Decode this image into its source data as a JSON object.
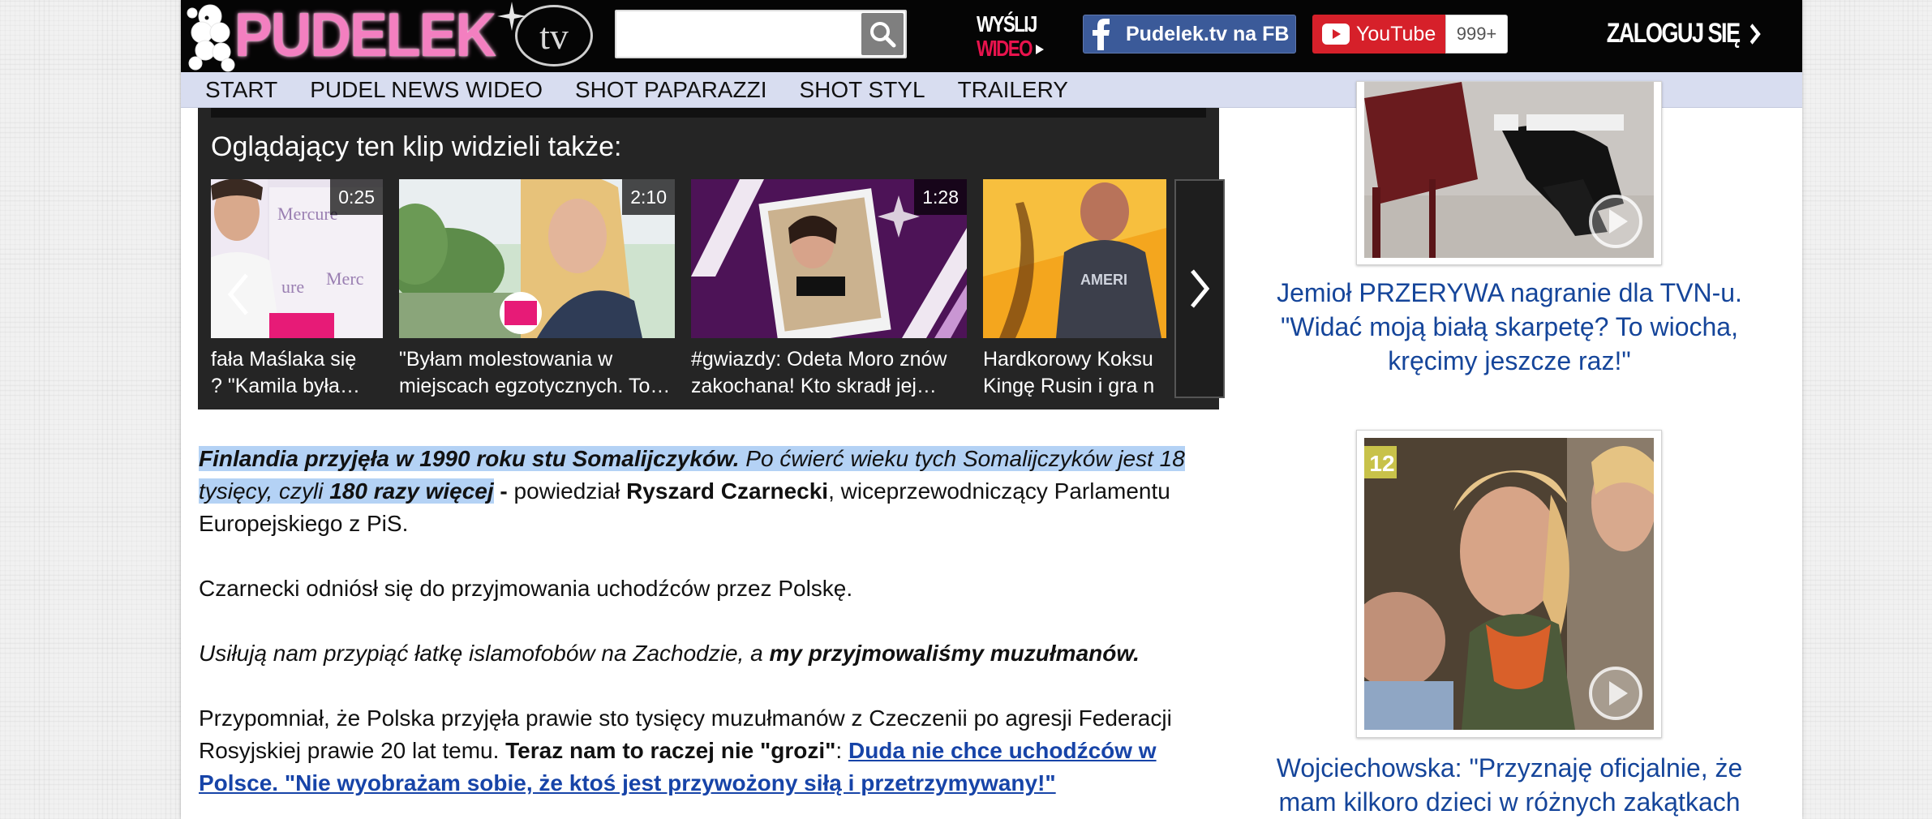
{
  "header": {
    "logo_text": "PUDELEK",
    "logo_suffix": "tv",
    "search": {
      "value": "",
      "placeholder": ""
    },
    "send_video": {
      "line1": "WYŚLIJ",
      "line2": "WIDEO"
    },
    "facebook_label": "Pudelek.tv na FB",
    "youtube_label": "YouTube",
    "youtube_count": "999+",
    "login_label": "ZALOGUJ SIĘ"
  },
  "nav": {
    "items": [
      "START",
      "PUDEL NEWS WIDEO",
      "SHOT PAPARAZZI",
      "SHOT STYL",
      "TRAILERY"
    ]
  },
  "related": {
    "title": "Oglądający ten klip widzieli także:",
    "items": [
      {
        "duration": "0:25",
        "line1": "fała Maślaka się",
        "line2": "? \"Kamila była…"
      },
      {
        "duration": "2:10",
        "line1": "\"Byłam molestowania w",
        "line2": "miejscach egzotycznych. To…"
      },
      {
        "duration": "1:28",
        "line1": "#gwiazdy: Odeta Moro znów",
        "line2": "zakochana! Kto skradł jej…"
      },
      {
        "duration": "",
        "line1": "Hardkorowy Koksu",
        "line2": "Kingę Rusin i gra n"
      }
    ]
  },
  "article": {
    "p1": {
      "b1": "Finlandia przyjęła w 1990 roku stu Somalijczyków.",
      "i1": " Po ćwierć wieku tych Somalijczyków jest 18 tysięcy, czyli ",
      "b2": "180 razy więcej",
      "dash": " - ",
      "t1": "powiedział ",
      "name": "Ryszard Czarnecki",
      "t2": ", wiceprzewodniczący Parlamentu Europejskiego z PiS."
    },
    "p2": "Czarnecki odniósł się do przyjmowania uchodźców przez Polskę.",
    "p3": {
      "i1": "Usiłują nam przypiąć łatkę islamofobów na Zachodzie, a ",
      "b1": "my przyjmowaliśmy muzułmanów."
    },
    "p4": {
      "t1": "Przypomniał, że Polska przyjęła prawie sto tysięcy muzułmanów z Czeczenii po agresji Federacji Rosyjskiej prawie 20 lat temu. ",
      "b1": "Teraz nam to raczej nie \"grozi\"",
      "t2": ": ",
      "link": "Duda nie chce uchodźców w Polsce. \"Nie wyobrażam sobie, że ktoś jest przywożony siłą i przetrzymywany!\""
    }
  },
  "sidebar": {
    "card1_title": "Jemioł PRZERYWA nagranie dla TVN-u. \"Widać moją białą skarpetę? To wiocha, kręcimy jeszcze raz!\"",
    "card2_badge": "12",
    "card2_title": "Wojciechowska: \"Przyznaję oficjalnie, że mam kilkoro dzieci w różnych zakątkach"
  },
  "colors": {
    "header_bg": "#050505",
    "logo_pink": "#f37fc0",
    "nav_bg": "#d8ddf0",
    "related_bg": "#252525",
    "link_blue": "#1744a8",
    "sidebar_title_blue": "#15459a",
    "highlight": "#b4d2f5",
    "facebook_blue": "#3b5a99",
    "youtube_red": "#d6202a"
  },
  "icons": {
    "search": "magnifier-icon",
    "facebook": "facebook-f-icon",
    "youtube": "play-triangle-icon",
    "login": "chevron-right-icon",
    "carousel_prev": "chevron-left-icon",
    "carousel_next": "chevron-right-icon",
    "video": "play-circle-icon"
  }
}
